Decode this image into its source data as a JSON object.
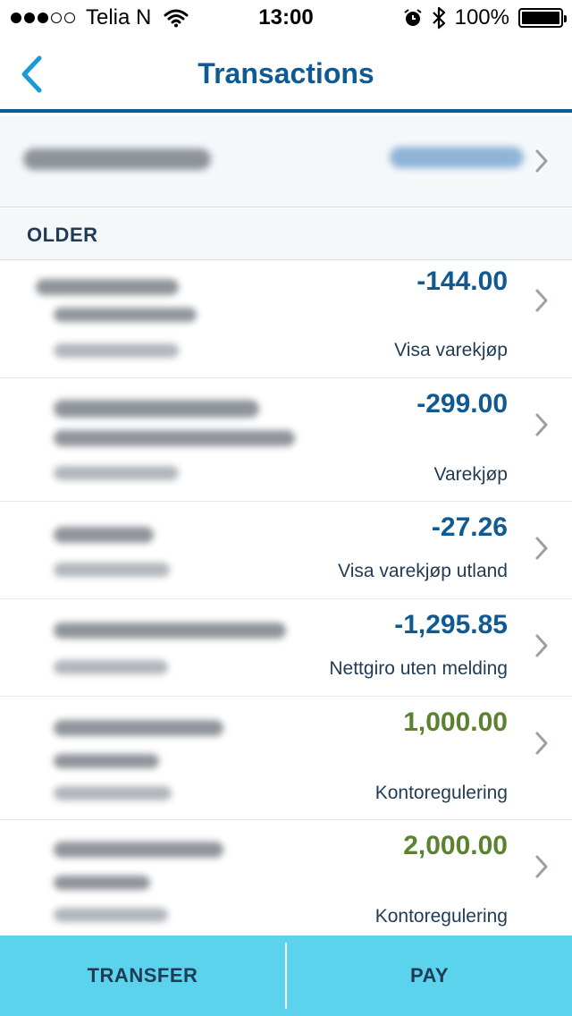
{
  "status_bar": {
    "carrier": "Telia N",
    "time": "13:00",
    "battery": "100%"
  },
  "nav": {
    "title": "Transactions"
  },
  "section": {
    "label": "OLDER"
  },
  "transactions": [
    {
      "amount": "-144.00",
      "type": "Visa varekjøp"
    },
    {
      "amount": "-299.00",
      "type": "Varekjøp"
    },
    {
      "amount": "-27.26",
      "type": "Visa varekjøp utland"
    },
    {
      "amount": "-1,295.85",
      "type": "Nettgiro uten melding"
    },
    {
      "amount": "1,000.00",
      "type": "Kontoregulering"
    },
    {
      "amount": "2,000.00",
      "type": "Kontoregulering"
    }
  ],
  "bottom_bar": {
    "transfer_label": "TRANSFER",
    "pay_label": "PAY"
  },
  "colors": {
    "accent": "#0f5a92",
    "positive": "#5a8230",
    "bottom_bar": "#5bd3ec"
  }
}
